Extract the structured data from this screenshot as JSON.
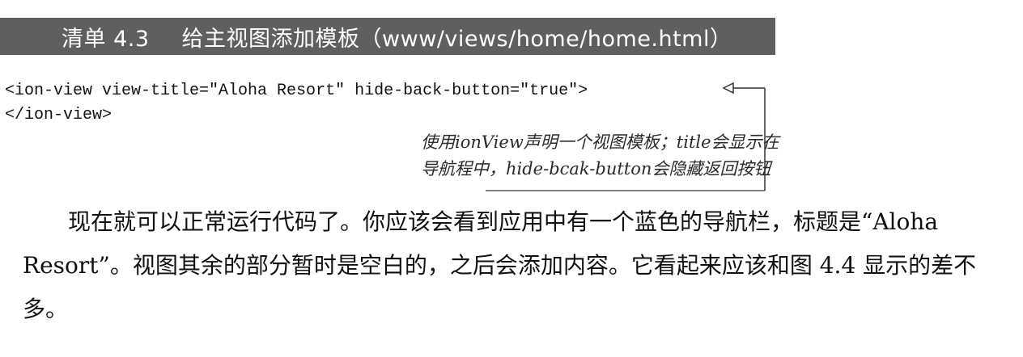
{
  "listing": {
    "number": "清单 4.3",
    "title": "给主视图添加模板（www/views/home/home.html）"
  },
  "code": {
    "line1": "<ion-view view-title=\"Aloha Resort\" hide-back-button=\"true\">",
    "line2": "</ion-view>"
  },
  "annotation": {
    "line1": "使用ionView声明一个视图模板；title会显示在",
    "line2": "导航程中，hide-bcak-button会隐藏返回按钮"
  },
  "body": {
    "paragraph": "现在就可以正常运行代码了。你应该会看到应用中有一个蓝色的导航栏，标题是“Aloha Resort”。视图其余的部分暂时是空白的，之后会添加内容。它看起来应该和图 4.4 显示的差不多。"
  }
}
